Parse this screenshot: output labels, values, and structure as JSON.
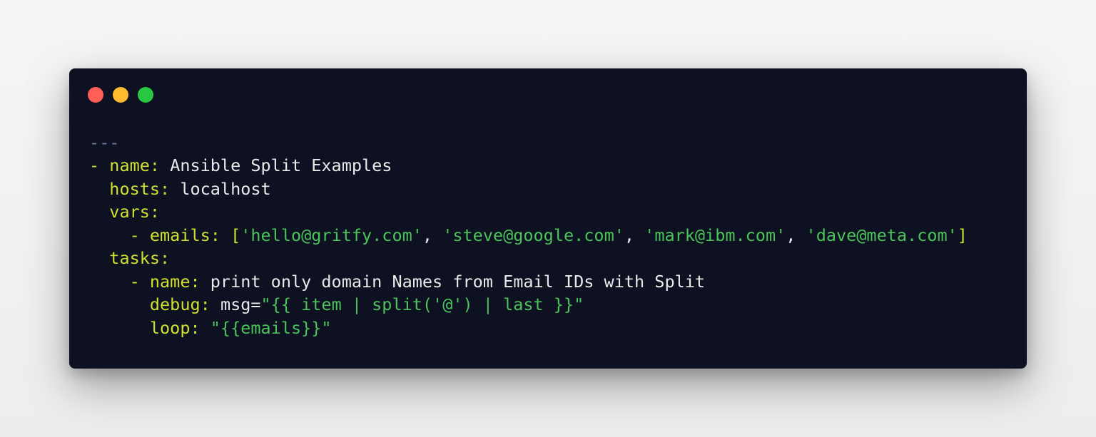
{
  "window": {
    "colors": {
      "background": "#0e1122",
      "key": "#d0e030",
      "string": "#4cc35a",
      "plain": "#eaeaea",
      "separator": "#6b7a9a"
    },
    "controls": {
      "close": "#ff5f57",
      "minimize": "#febc2e",
      "maximize": "#28c840"
    }
  },
  "code": {
    "separator": "---",
    "lines": [
      {
        "dash": "- ",
        "key": "name",
        "colon": ": ",
        "value": "Ansible Split Examples"
      },
      {
        "indent": "  ",
        "key": "hosts",
        "colon": ": ",
        "value": "localhost"
      },
      {
        "indent": "  ",
        "key": "vars",
        "colon": ":"
      },
      {
        "indent": "    ",
        "dash": "- ",
        "key": "emails",
        "colon": ": ",
        "open_bracket": "[",
        "items": [
          "'hello@gritfy.com'",
          "'steve@google.com'",
          "'mark@ibm.com'",
          "'dave@meta.com'"
        ],
        "comma": ", ",
        "close_bracket": "]"
      },
      {
        "indent": "  ",
        "key": "tasks",
        "colon": ":"
      },
      {
        "indent": "    ",
        "dash": "- ",
        "key": "name",
        "colon": ": ",
        "value": "print only domain Names from Email IDs with Split"
      },
      {
        "indent": "      ",
        "key": "debug",
        "colon": ": ",
        "prefix": "msg=",
        "string": "\"{{ item | split('@') | last }}\""
      },
      {
        "indent": "      ",
        "key": "loop",
        "colon": ": ",
        "string": "\"{{emails}}\""
      }
    ]
  }
}
